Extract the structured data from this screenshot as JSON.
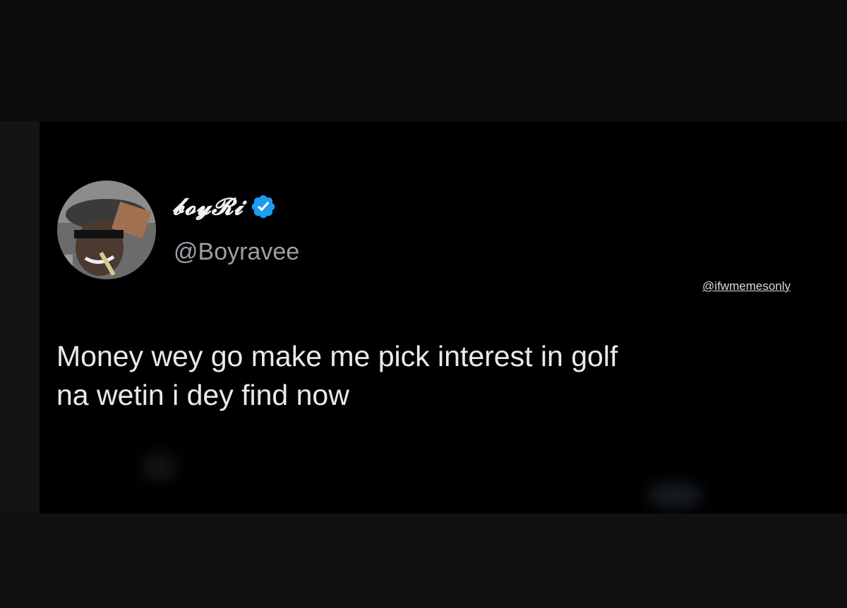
{
  "tweet": {
    "display_name": "𝓫𝓸𝔂𝓡𝓲",
    "handle": "@Boyravee",
    "verified": true,
    "text_lines": [
      "Money wey go make me pick interest in golf",
      "na wetin i dey find now"
    ]
  },
  "watermark": "@ifwmemesonly",
  "colors": {
    "background": "#000000",
    "text": "#eaeaea",
    "handle": "#9aa0a6",
    "verified": "#1d9bf0"
  }
}
